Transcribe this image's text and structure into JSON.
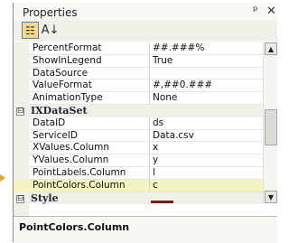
{
  "panel": {
    "title": "Properties",
    "pin_glyph": "ᵖ",
    "close_glyph": "✕"
  },
  "toolbar": {
    "categorized_glyph": "☷",
    "alphabetical_glyph": "A↓"
  },
  "grid": {
    "rows": [
      {
        "type": "prop",
        "name": "PercentFormat",
        "value": "##.###%"
      },
      {
        "type": "prop",
        "name": "ShowInLegend",
        "value": "True"
      },
      {
        "type": "prop",
        "name": "DataSource",
        "value": ""
      },
      {
        "type": "prop",
        "name": "ValueFormat",
        "value": "#,##0.###"
      },
      {
        "type": "prop",
        "name": "AnimationType",
        "value": "None"
      },
      {
        "type": "category",
        "name": "IXDataSet",
        "expander": "⊟"
      },
      {
        "type": "prop",
        "name": "DataID",
        "value": "ds"
      },
      {
        "type": "prop",
        "name": "ServiceID",
        "value": "Data.csv"
      },
      {
        "type": "prop",
        "name": "XValues.Column",
        "value": "x"
      },
      {
        "type": "prop",
        "name": "YValues.Column",
        "value": "y"
      },
      {
        "type": "prop",
        "name": "PointLabels.Column",
        "value": "l"
      },
      {
        "type": "prop",
        "name": "PointColors.Column",
        "value": "c",
        "selected": true
      },
      {
        "type": "category",
        "name": "Style",
        "expander": "⊟"
      }
    ]
  },
  "scrollbar": {
    "up_glyph": "▲",
    "down_glyph": "▼"
  },
  "description": {
    "title": "PointColors.Column"
  },
  "colors": {
    "selection": "#f5f3c0",
    "category_bg": "#f0efe8",
    "swatch": "#7a1c1c",
    "accent_arrow": "#f0a030"
  }
}
